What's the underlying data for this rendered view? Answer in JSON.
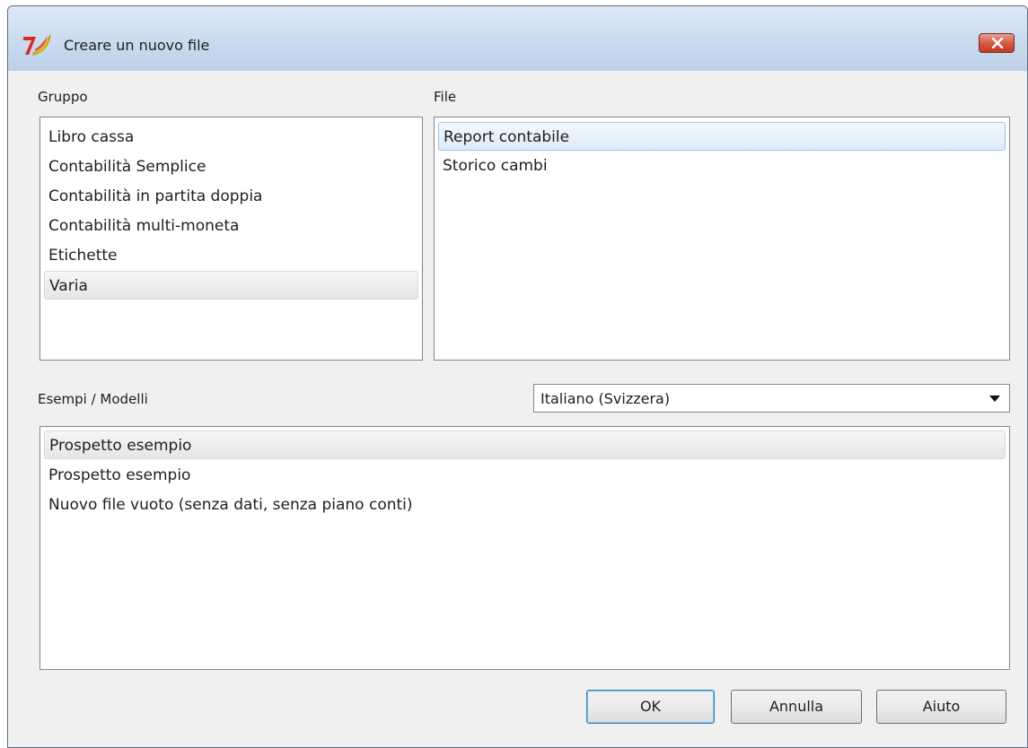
{
  "window": {
    "title": "Creare un nuovo file"
  },
  "groups": {
    "label": "Gruppo",
    "items": [
      "Libro cassa",
      "Contabilità Semplice",
      "Contabilità in partita doppia",
      "Contabilità multi-moneta",
      "Etichette",
      "Varia"
    ],
    "selected": "Varia"
  },
  "files": {
    "label": "File",
    "items": [
      "Report contabile",
      "Storico cambi"
    ],
    "selected": "Report contabile"
  },
  "templates": {
    "label": "Esempi / Modelli",
    "language": "Italiano (Svizzera)",
    "items": [
      "Prospetto esempio",
      "Prospetto esempio",
      "Nuovo file vuoto (senza dati, senza piano conti)"
    ],
    "selected_index": 0
  },
  "buttons": {
    "ok": "OK",
    "cancel": "Annulla",
    "help": "Aiuto"
  },
  "colors": {
    "selection_blue": "#9fc3ea",
    "default_button": "#3c7fb1",
    "close_red": "#c23a25"
  }
}
